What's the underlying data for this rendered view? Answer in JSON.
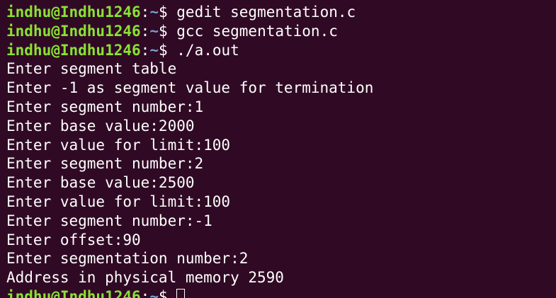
{
  "prompt": {
    "user_host": "indhu@Indhu1246",
    "colon": ":",
    "path": "~",
    "symbol": "$"
  },
  "commands": [
    "gedit segmentation.c",
    "gcc segmentation.c",
    "./a.out"
  ],
  "output": [
    "Enter segment table",
    "Enter -1 as segment value for termination",
    "Enter segment number:1",
    "Enter base value:2000",
    "Enter value for limit:100",
    "Enter segment number:2",
    "Enter base value:2500",
    "Enter value for limit:100",
    "Enter segment number:-1",
    "Enter offset:90",
    "Enter segmentation number:2",
    "Address in physical memory 2590"
  ],
  "colors": {
    "background": "#300a24",
    "user_host": "#8ae234",
    "path": "#729fcf",
    "text": "#ffffff"
  }
}
